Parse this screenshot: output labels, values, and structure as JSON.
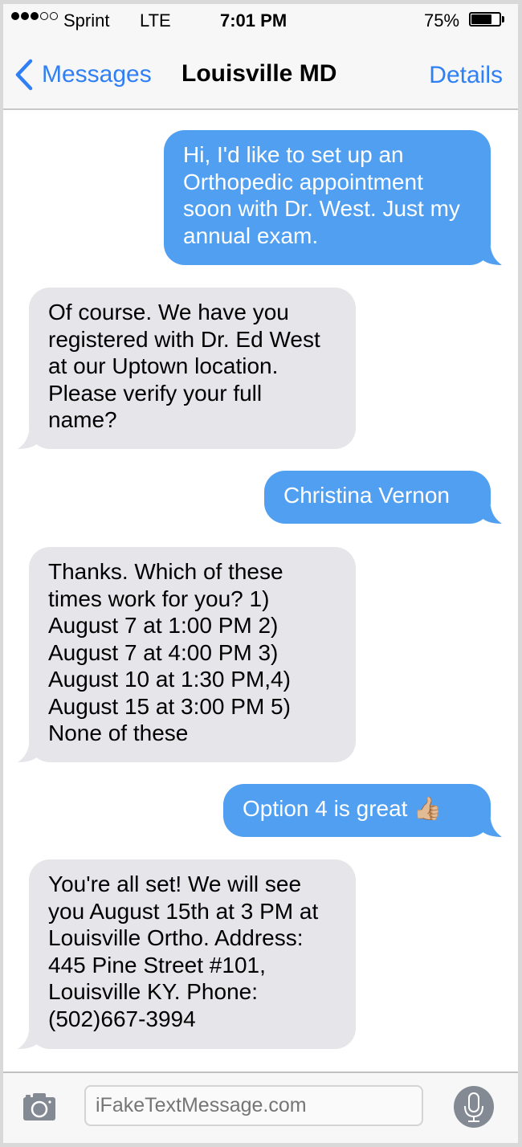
{
  "status_bar": {
    "signal_dots_filled": 3,
    "signal_dots_total": 5,
    "carrier": "Sprint",
    "network": "LTE",
    "time": "7:01 PM",
    "battery_percent_label": "75%",
    "battery_level": 0.75
  },
  "nav": {
    "back_label": "Messages",
    "title": "Louisville MD",
    "details_label": "Details"
  },
  "colors": {
    "accent": "#2f7ff5",
    "sent_bubble": "#519ff1",
    "received_bubble": "#e5e5ea"
  },
  "messages": [
    {
      "direction": "sent",
      "text": "Hi, I'd like to set up an Orthopedic appointment soon with Dr. West. Just my annual exam."
    },
    {
      "direction": "received",
      "text": "Of course. We have you registered with Dr. Ed West at our Uptown location. Please verify your full name?"
    },
    {
      "direction": "sent",
      "text": "Christina Vernon"
    },
    {
      "direction": "received",
      "text": "Thanks. Which of these times work for you? 1) August 7 at 1:00 PM 2) August 7 at 4:00 PM 3) August 10 at 1:30 PM,4) August 15 at 3:00 PM 5) None of these"
    },
    {
      "direction": "sent",
      "text": "Option 4 is great 👍🏼"
    },
    {
      "direction": "received",
      "text": "You're all set! We will see you August 15th at 3 PM at Louisville Ortho. Address: 445 Pine Street #101, Louisville KY. Phone: (502)667-3994"
    }
  ],
  "input_bar": {
    "camera_icon": "camera-icon",
    "placeholder": "iFakeTextMessage.com",
    "mic_icon": "microphone-icon"
  }
}
